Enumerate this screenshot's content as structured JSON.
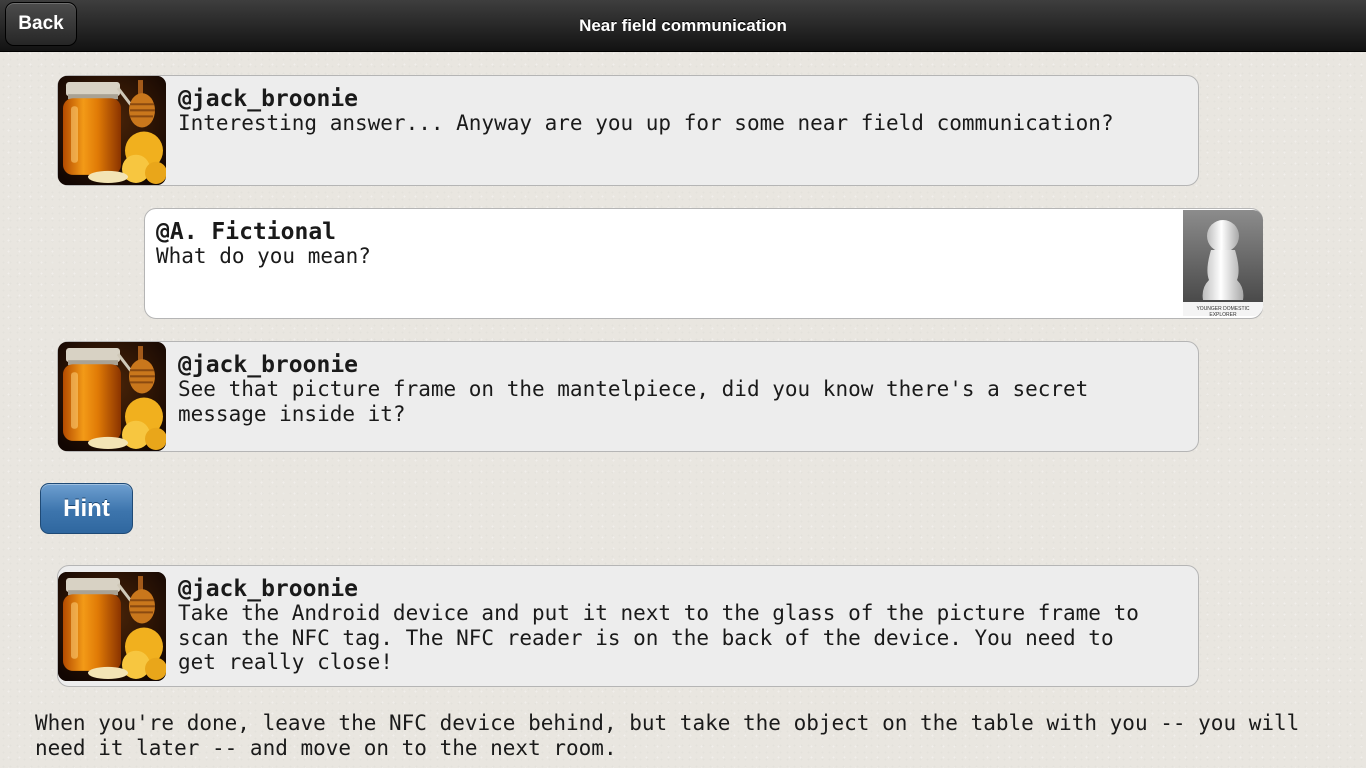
{
  "header": {
    "back_label": "Back",
    "title": "Near field communication"
  },
  "messages": [
    {
      "author": "@jack_broonie",
      "text": "Interesting answer... Anyway are you up for some near field communication?",
      "avatar": "honey-jar-icon"
    },
    {
      "author": "@A. Fictional",
      "text": "What do you mean?",
      "avatar": "white-pawn-icon",
      "avatar_caption": "YOUNGER DOMESTIC EXPLORER"
    },
    {
      "author": "@jack_broonie",
      "text": "See that picture frame on the mantelpiece, did you know there's a secret\nmessage inside it?",
      "avatar": "honey-jar-icon"
    },
    {
      "author": "@jack_broonie",
      "text": "Take the Android device and put it next to the glass of the picture frame to\nscan the NFC tag. The NFC reader is on the back of the device. You need to\nget really close!",
      "avatar": "honey-jar-icon"
    }
  ],
  "hint_label": "Hint",
  "footer_text": "When you're done, leave the NFC device behind, but take the object on the table with you -- you will need it later -- and move on to the next room.",
  "colors": {
    "bubble_bg": "#ededed",
    "user_bubble_bg": "#ffffff",
    "hint_button": "#3d75ad",
    "topbar": "#1e1e1e"
  }
}
